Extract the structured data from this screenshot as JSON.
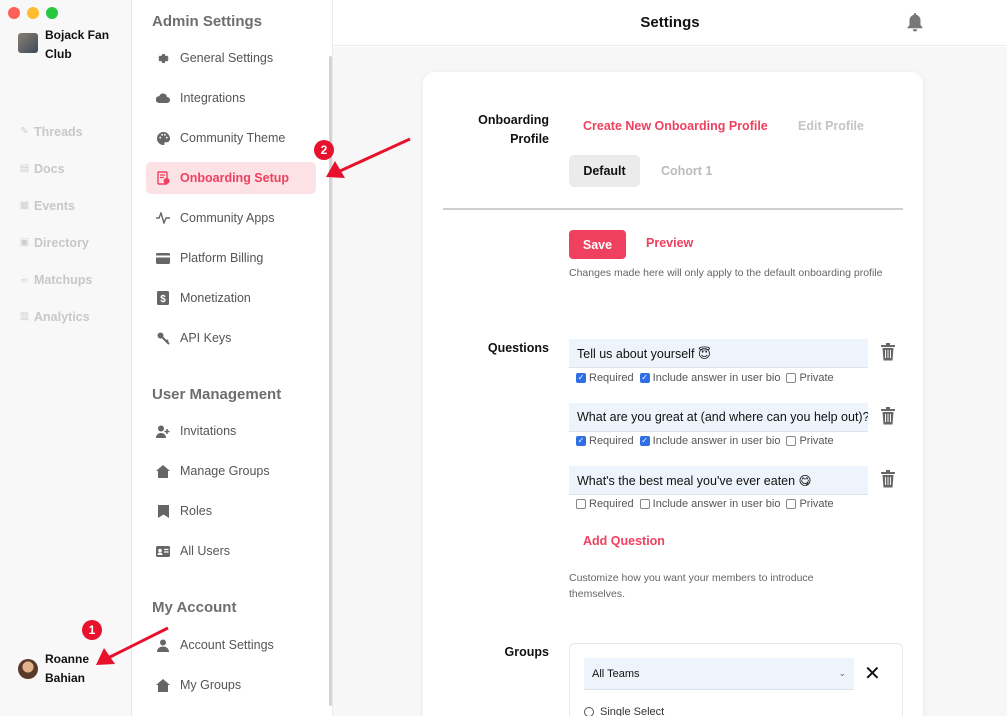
{
  "app": {
    "title": "Settings"
  },
  "colors": {
    "accent": "#f0405f",
    "active_bg": "#fde2e5",
    "annotation": "#e8122d",
    "checkbox": "#2f6fe4"
  },
  "community": {
    "name": "Bojack Fan Club"
  },
  "rail": {
    "items": [
      {
        "label": "Threads",
        "icon": "pencil-icon"
      },
      {
        "label": "Docs",
        "icon": "document-icon"
      },
      {
        "label": "Events",
        "icon": "calendar-icon"
      },
      {
        "label": "Directory",
        "icon": "directory-icon"
      },
      {
        "label": "Matchups",
        "icon": "coffee-icon"
      },
      {
        "label": "Analytics",
        "icon": "chart-icon"
      }
    ]
  },
  "user": {
    "name": "Roanne Bahian"
  },
  "sidebar": {
    "admin_title": "Admin Settings",
    "admin_items": [
      {
        "label": "General Settings",
        "icon": "gear-icon"
      },
      {
        "label": "Integrations",
        "icon": "cloud-icon"
      },
      {
        "label": "Community Theme",
        "icon": "palette-icon"
      },
      {
        "label": "Onboarding Setup",
        "icon": "onboarding-icon"
      },
      {
        "label": "Community Apps",
        "icon": "pulse-icon"
      },
      {
        "label": "Platform Billing",
        "icon": "credit-card-icon"
      },
      {
        "label": "Monetization",
        "icon": "dollar-icon"
      },
      {
        "label": "API Keys",
        "icon": "key-icon"
      }
    ],
    "user_mgmt_title": "User Management",
    "user_mgmt_items": [
      {
        "label": "Invitations",
        "icon": "add-user-icon"
      },
      {
        "label": "Manage Groups",
        "icon": "home-icon"
      },
      {
        "label": "Roles",
        "icon": "bookmark-icon"
      },
      {
        "label": "All Users",
        "icon": "id-card-icon"
      }
    ],
    "account_title": "My Account",
    "account_items": [
      {
        "label": "Account Settings",
        "icon": "user-icon"
      },
      {
        "label": "My Groups",
        "icon": "home-icon"
      }
    ]
  },
  "onboarding": {
    "profile_label": "Onboarding Profile",
    "create_link": "Create New Onboarding Profile",
    "edit_link": "Edit Profile",
    "tabs": [
      "Default",
      "Cohort 1"
    ],
    "save_label": "Save",
    "preview_label": "Preview",
    "save_note": "Changes made here will only apply to the default onboarding profile",
    "questions_label": "Questions",
    "questions": [
      {
        "text": "Tell us about yourself 😇",
        "required": true,
        "include_bio": true,
        "private": false
      },
      {
        "text": "What are you great at (and where can you help out)?",
        "required": true,
        "include_bio": true,
        "private": false
      },
      {
        "text": "What's the best meal you've ever eaten 😋",
        "required": false,
        "include_bio": false,
        "private": false
      }
    ],
    "option_labels": {
      "required": "Required",
      "include_bio": "Include answer in user bio",
      "private": "Private"
    },
    "add_question": "Add Question",
    "questions_note": "Customize how you want your members to introduce themselves.",
    "groups_label": "Groups",
    "groups_select": "All Teams",
    "radio_label": "Single Select"
  },
  "annotations": {
    "badge1": "1",
    "badge2": "2"
  }
}
